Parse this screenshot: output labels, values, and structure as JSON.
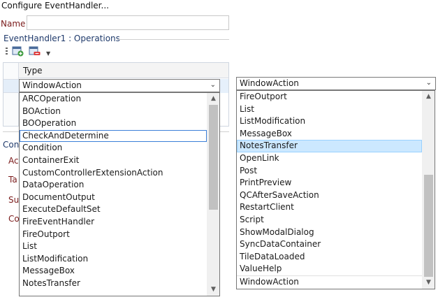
{
  "window": {
    "title": "Configure EventHandler..."
  },
  "name_field": {
    "label": "Name",
    "value": ""
  },
  "operations": {
    "group_label": "EventHandler1 : Operations"
  },
  "toolbar": {
    "icons": [
      "add-operation-icon",
      "delete-operation-icon",
      "dropdown-arrow-icon"
    ]
  },
  "grid": {
    "columns": [
      "Type"
    ],
    "selected_row": 0
  },
  "behind_labels": [
    "Con",
    "Ac",
    "Ta",
    "Su",
    "Co"
  ],
  "left_combo": {
    "value": "WindowAction"
  },
  "left_dropdown": {
    "items": [
      "ARCOperation",
      "BOAction",
      "BOOperation",
      "CheckAndDetermine",
      "Condition",
      "ContainerExit",
      "CustomControllerExtensionAction",
      "DataOperation",
      "DocumentOutput",
      "ExecuteDefaultSet",
      "FireEventHandler",
      "FireOutport",
      "List",
      "ListModification",
      "MessageBox",
      "NotesTransfer"
    ],
    "focused": "CheckAndDetermine"
  },
  "right_combo": {
    "value": "WindowAction"
  },
  "right_dropdown": {
    "items": [
      "FireOutport",
      "List",
      "ListModification",
      "MessageBox",
      "NotesTransfer",
      "OpenLink",
      "Post",
      "PrintPreview",
      "QCAfterSaveAction",
      "RestartClient",
      "Script",
      "ShowModalDialog",
      "SyncDataContainer",
      "TileDataLoaded",
      "ValueHelp",
      "WindowAction"
    ],
    "highlighted": "NotesTransfer"
  },
  "colors": {
    "highlight": "#cce8ff",
    "label_red": "#7a1b1b",
    "label_blue": "#1f3a6b"
  }
}
